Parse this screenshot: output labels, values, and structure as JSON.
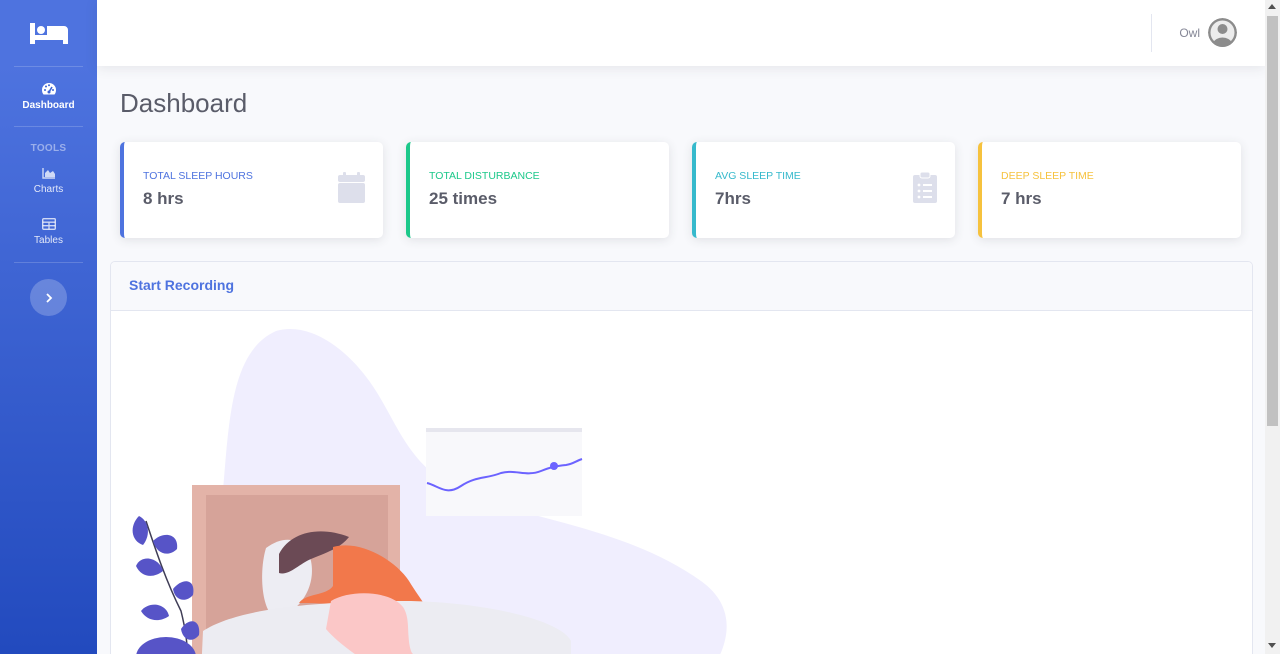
{
  "sidebar": {
    "brand_icon": "bed-icon",
    "items": [
      {
        "label": "Dashboard",
        "icon": "tachometer-icon",
        "active": true
      },
      {
        "label": "Charts",
        "icon": "chart-area-icon"
      },
      {
        "label": "Tables",
        "icon": "table-icon"
      }
    ],
    "heading": "TOOLS",
    "toggle_icon": "chevron-right-icon"
  },
  "topbar": {
    "user_name": "Owl",
    "avatar_icon": "user-avatar-icon"
  },
  "page": {
    "title": "Dashboard"
  },
  "cards": [
    {
      "title": "TOTAL SLEEP HOURS",
      "value": "8 hrs",
      "color": "#4e73df",
      "icon": "calendar-icon"
    },
    {
      "title": "TOTAL DISTURBANCE",
      "value": "25 times",
      "color": "#1cc88a",
      "icon": ""
    },
    {
      "title": "AVG SLEEP TIME",
      "value": "7hrs",
      "color": "#36b9cc",
      "icon": "clipboard-list-icon"
    },
    {
      "title": "DEEP SLEEP TIME",
      "value": "7 hrs",
      "color": "#f6c23e",
      "icon": ""
    }
  ],
  "panel": {
    "title": "Start Recording"
  },
  "colors": {
    "primary": "#4e73df",
    "success": "#1cc88a",
    "info": "#36b9cc",
    "warning": "#f6c23e",
    "text": "#5a5c69"
  }
}
